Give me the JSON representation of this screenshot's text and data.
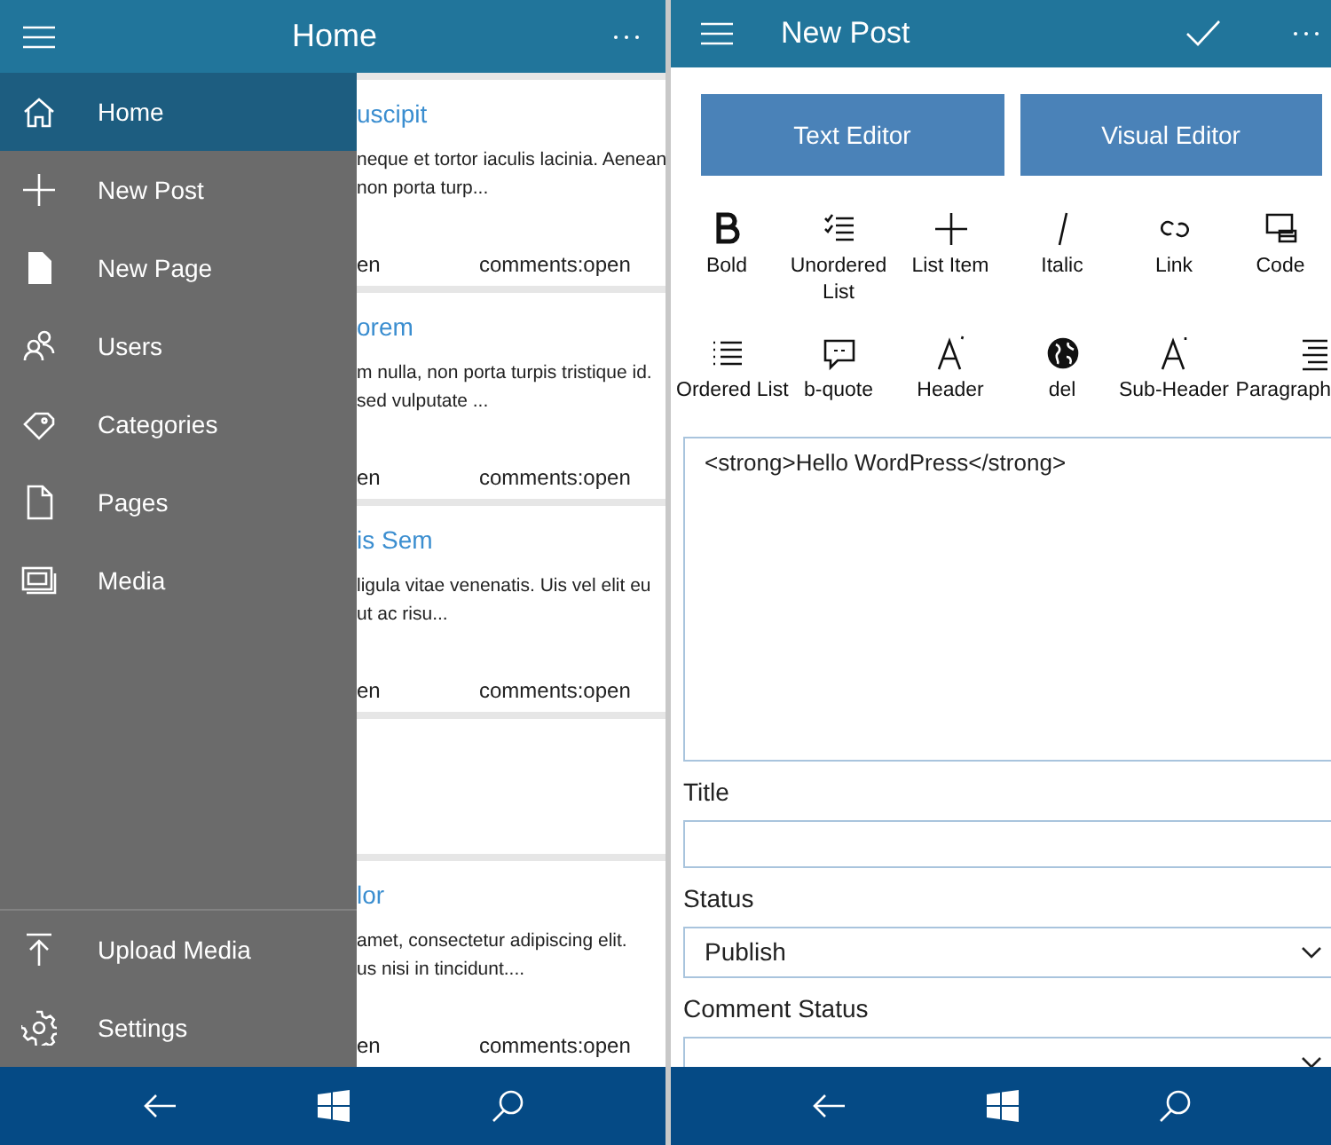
{
  "left_screen": {
    "header": {
      "title": "Home"
    },
    "nav_menu": {
      "items": [
        {
          "label": "Home",
          "selected": true
        },
        {
          "label": "New Post",
          "selected": false
        },
        {
          "label": "New Page",
          "selected": false
        },
        {
          "label": "Users",
          "selected": false
        },
        {
          "label": "Categories",
          "selected": false
        },
        {
          "label": "Pages",
          "selected": false
        },
        {
          "label": "Media",
          "selected": false
        }
      ],
      "footer_items": [
        {
          "label": "Upload Media",
          "selected": false
        },
        {
          "label": "Settings",
          "selected": false
        }
      ]
    },
    "posts": [
      {
        "kind": "post",
        "title": "uscipit",
        "excerpt": [
          "neque et tortor iaculis lacinia. Aenean",
          "non porta turp..."
        ],
        "status": "en",
        "comments": "comments:open"
      },
      {
        "kind": "post",
        "title": "orem",
        "excerpt": [
          "m nulla, non porta turpis tristique id.",
          "sed vulputate ..."
        ],
        "status": "en",
        "comments": "comments:open"
      },
      {
        "kind": "post",
        "title": "is Sem",
        "excerpt": [
          "ligula vitae venenatis. Uis vel elit eu",
          "ut ac risu..."
        ],
        "status": "en",
        "comments": "comments:open"
      },
      {
        "kind": "blank"
      },
      {
        "kind": "post",
        "title": "lor",
        "excerpt": [
          "amet, consectetur adipiscing elit.",
          "us nisi in tincidunt...."
        ],
        "status": "en",
        "comments": "comments:open"
      }
    ]
  },
  "right_screen": {
    "header": {
      "title": "New Post"
    },
    "editor_buttons": [
      "Text Editor",
      "Visual Editor"
    ],
    "toolbar": [
      "Bold",
      "Unordered List",
      "List Item",
      "Italic",
      "Link",
      "Code",
      "Ordered List",
      "b-quote",
      "Header",
      "del",
      "Sub-Header",
      "Paragraph"
    ],
    "content": "<strong>Hello WordPress</strong>",
    "fields": [
      {
        "label": "Title",
        "kind": "text"
      },
      {
        "label": "Status",
        "kind": "select",
        "value": "Publish"
      },
      {
        "label": "Comment Status",
        "kind": "select"
      }
    ]
  }
}
